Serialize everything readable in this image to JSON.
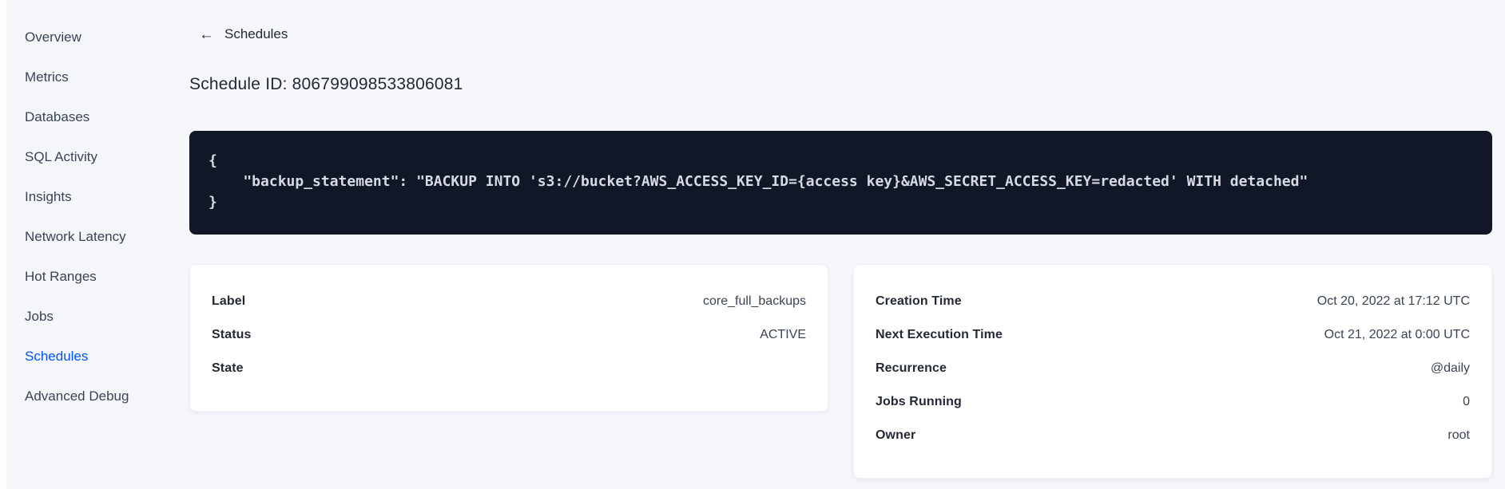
{
  "colors": {
    "accent_blue": "#0055ff",
    "page_bg": "#f4f6fa",
    "code_bg": "#111726",
    "code_text": "#d6dae2",
    "text_dark": "#242a35",
    "text_slate": "#394455"
  },
  "sidebar": {
    "items": [
      {
        "label": "Overview"
      },
      {
        "label": "Metrics"
      },
      {
        "label": "Databases"
      },
      {
        "label": "SQL Activity"
      },
      {
        "label": "Insights"
      },
      {
        "label": "Network Latency"
      },
      {
        "label": "Hot Ranges"
      },
      {
        "label": "Jobs"
      },
      {
        "label": "Schedules"
      },
      {
        "label": "Advanced Debug"
      }
    ],
    "active_item": "Schedules"
  },
  "header": {
    "back_icon": "←",
    "back_label": "Schedules",
    "title": "Schedule ID: 806799098533806081"
  },
  "schedule_code": {
    "content": "{\n    \"backup_statement\": \"BACKUP INTO 's3://bucket?AWS_ACCESS_KEY_ID={access key}&AWS_SECRET_ACCESS_KEY=redacted' WITH detached\"\n}"
  },
  "details_left": {
    "rows": [
      {
        "label": "Label",
        "value": "core_full_backups"
      },
      {
        "label": "Status",
        "value": "ACTIVE"
      },
      {
        "label": "State",
        "value": ""
      }
    ]
  },
  "details_right": {
    "rows": [
      {
        "label": "Creation Time",
        "value": "Oct 20, 2022 at 17:12 UTC"
      },
      {
        "label": "Next Execution Time",
        "value": "Oct 21, 2022 at 0:00 UTC"
      },
      {
        "label": "Recurrence",
        "value": "@daily"
      },
      {
        "label": "Jobs Running",
        "value": "0"
      },
      {
        "label": "Owner",
        "value": "root"
      }
    ]
  }
}
